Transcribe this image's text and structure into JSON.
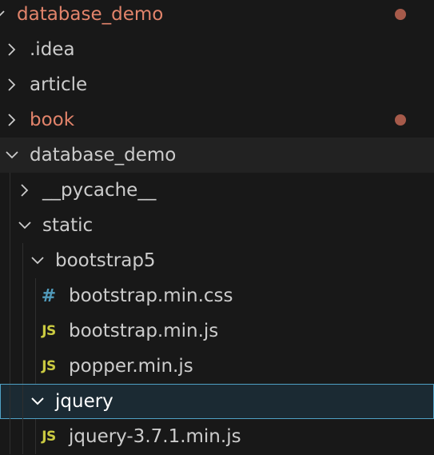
{
  "colors": {
    "background": "#181818",
    "text": "#cccccc",
    "modified_text": "#e2846b",
    "modified_dot": "#a65a4a",
    "selection_border": "#4fa0c4",
    "css_icon": "#519aba",
    "js_icon": "#cbcb41"
  },
  "tree": {
    "root": {
      "label": "database_demo",
      "expanded": true,
      "modified": true
    },
    "items": [
      {
        "label": ".idea",
        "type": "folder",
        "expanded": false
      },
      {
        "label": "article",
        "type": "folder",
        "expanded": false
      },
      {
        "label": "book",
        "type": "folder",
        "expanded": false,
        "modified": true
      },
      {
        "label": "database_demo",
        "type": "folder",
        "expanded": true
      },
      {
        "label": "__pycache__",
        "type": "folder",
        "expanded": false
      },
      {
        "label": "static",
        "type": "folder",
        "expanded": true
      },
      {
        "label": "bootstrap5",
        "type": "folder",
        "expanded": true
      },
      {
        "label": "bootstrap.min.css",
        "type": "file",
        "icon": "css-hash-icon",
        "icon_glyph": "#"
      },
      {
        "label": "bootstrap.min.js",
        "type": "file",
        "icon": "js-icon",
        "icon_glyph": "JS"
      },
      {
        "label": "popper.min.js",
        "type": "file",
        "icon": "js-icon",
        "icon_glyph": "JS"
      },
      {
        "label": "jquery",
        "type": "folder",
        "expanded": true,
        "selected": true
      },
      {
        "label": "jquery-3.7.1.min.js",
        "type": "file",
        "icon": "js-icon",
        "icon_glyph": "JS"
      }
    ]
  }
}
